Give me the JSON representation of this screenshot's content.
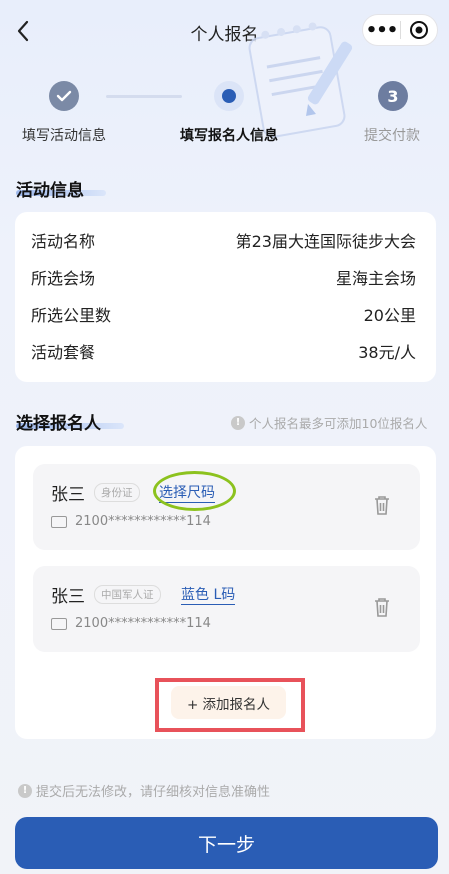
{
  "header": {
    "title": "个人报名"
  },
  "steps": [
    {
      "label": "填写活动信息",
      "state": "done"
    },
    {
      "label": "填写报名人信息",
      "state": "current"
    },
    {
      "label": "提交付款",
      "state": "pending",
      "number": "3"
    }
  ],
  "activity": {
    "section_title": "活动信息",
    "rows": [
      {
        "label": "活动名称",
        "value": "第23届大连国际徒步大会"
      },
      {
        "label": "所选会场",
        "value": "星海主会场"
      },
      {
        "label": "所选公里数",
        "value": "20公里"
      },
      {
        "label": "活动套餐",
        "value": "38元/人"
      }
    ]
  },
  "registrants": {
    "section_title": "选择报名人",
    "hint": "个人报名最多可添加10位报名人",
    "people": [
      {
        "name": "张三",
        "id_type": "身份证",
        "size": "选择尺码",
        "id_number": "2100************114"
      },
      {
        "name": "张三",
        "id_type": "中国军人证",
        "size": "蓝色 L码",
        "id_number": "2100************114"
      }
    ],
    "add_label": "+ 添加报名人"
  },
  "footer": {
    "notice": "提交后无法修改，请仔细核对信息准确性",
    "next_label": "下一步"
  },
  "colors": {
    "primary": "#2a5db5",
    "highlight_red": "#e8525a",
    "highlight_green": "#8cc21e"
  }
}
